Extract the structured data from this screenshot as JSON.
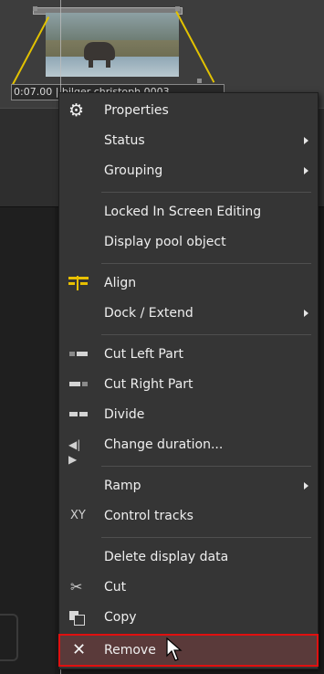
{
  "timeline": {
    "clip_label": "0:07.00 | bilger christoph 0003"
  },
  "menu": {
    "items": [
      {
        "label": "Properties",
        "icon": "gear-icon",
        "submenu": false
      },
      {
        "label": "Status",
        "icon": "",
        "submenu": true
      },
      {
        "label": "Grouping",
        "icon": "",
        "submenu": true
      },
      {
        "label": "Locked In Screen Editing",
        "icon": "",
        "submenu": false
      },
      {
        "label": "Display pool object",
        "icon": "",
        "submenu": false
      },
      {
        "label": "Align",
        "icon": "align-icon",
        "submenu": false
      },
      {
        "label": "Dock / Extend",
        "icon": "",
        "submenu": true
      },
      {
        "label": "Cut Left Part",
        "icon": "cut-left-icon",
        "submenu": false
      },
      {
        "label": "Cut Right Part",
        "icon": "cut-right-icon",
        "submenu": false
      },
      {
        "label": "Divide",
        "icon": "divide-icon",
        "submenu": false
      },
      {
        "label": "Change duration...",
        "icon": "change-duration-icon",
        "submenu": false
      },
      {
        "label": "Ramp",
        "icon": "",
        "submenu": true
      },
      {
        "label": "Control tracks",
        "icon": "control-tracks-icon",
        "submenu": false
      },
      {
        "label": "Delete display data",
        "icon": "",
        "submenu": false
      },
      {
        "label": "Cut",
        "icon": "scissors-icon",
        "submenu": false
      },
      {
        "label": "Copy",
        "icon": "copy-icon",
        "submenu": false
      },
      {
        "label": "Remove",
        "icon": "x-icon",
        "submenu": false,
        "highlighted": true
      }
    ]
  },
  "colors": {
    "menu_bg": "#353535",
    "highlight_border": "#e01010",
    "align_icon": "#e8c000"
  }
}
